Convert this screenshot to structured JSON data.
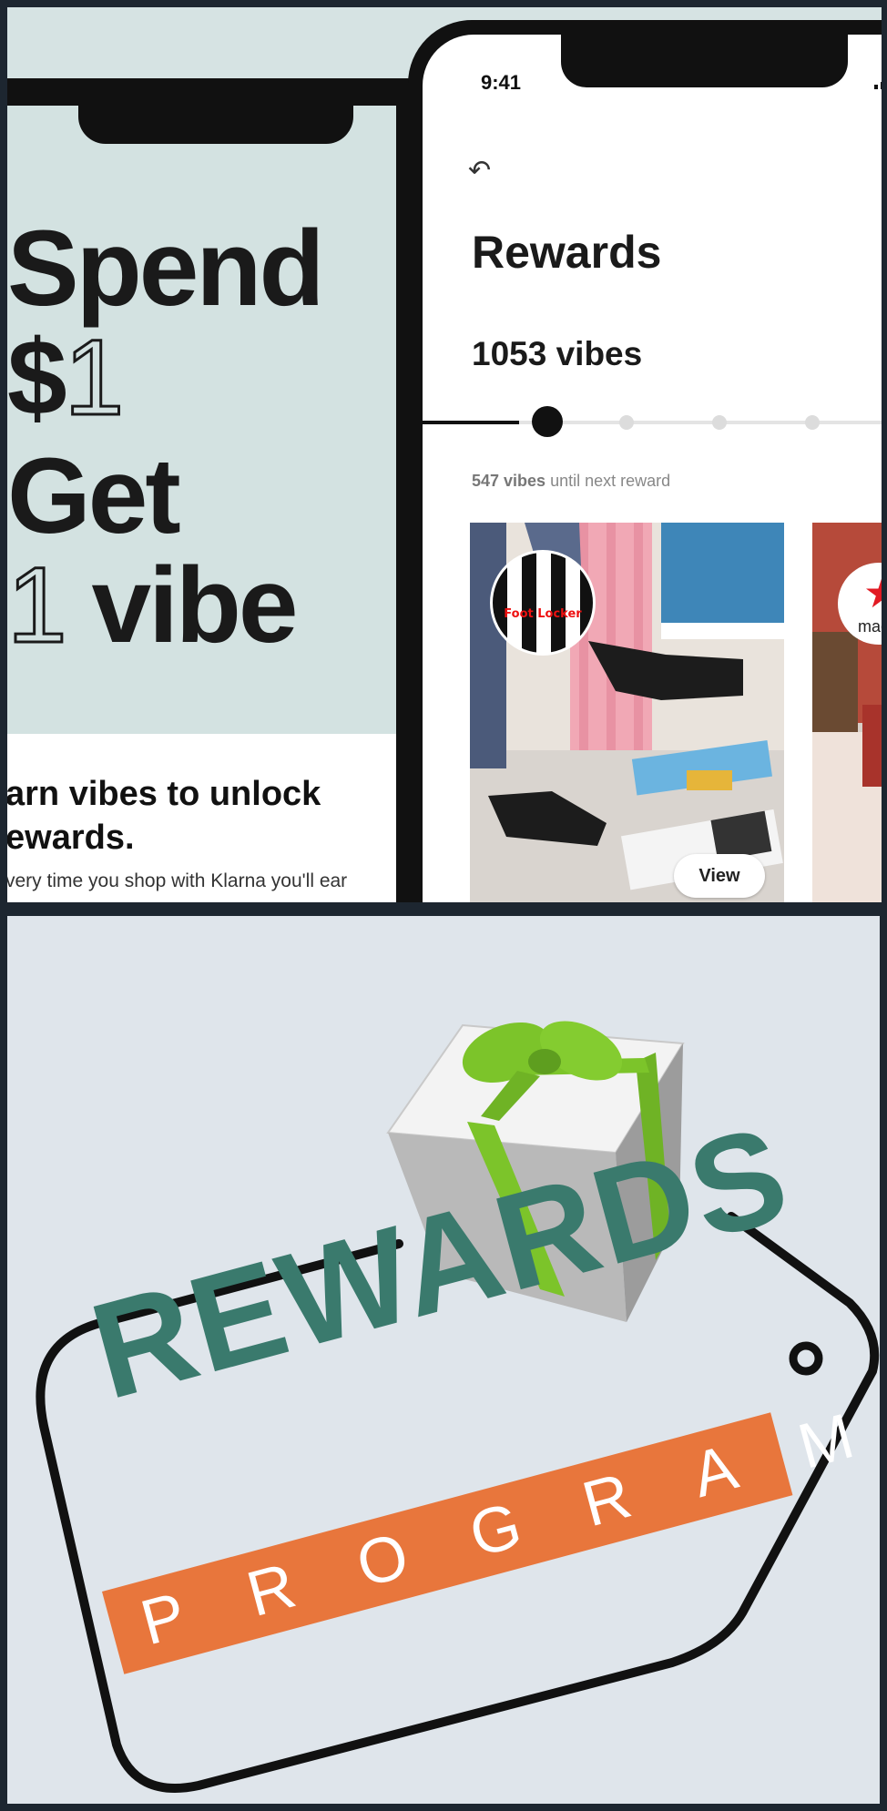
{
  "promo": {
    "line1": "Spend",
    "line2_currency": "$",
    "line2_number": "1",
    "line3": "Get",
    "line4_number": "1",
    "line4_word": "vibe",
    "heading": "arn vibes to unlock\newards.",
    "body": "very time you shop with Klarna you'll ear"
  },
  "app": {
    "status_time": "9:41",
    "title": "Rewards",
    "vibes_count": "1053 vibes",
    "vibes_remaining_bold": "547 vibes",
    "vibes_remaining_rest": "until next reward",
    "progress_fraction": 0.2,
    "cards": [
      {
        "brand": "Foot Locker",
        "button": "View"
      },
      {
        "brand": "mac"
      }
    ]
  },
  "program": {
    "rewards_word": "REWARDS",
    "program_word": "PROGRAM",
    "colors": {
      "rewards_green": "#3a7a6d",
      "band_orange": "#e8763c",
      "ribbon_green": "#7cc42a"
    }
  },
  "icons": [
    "back-arrow-icon",
    "signal-icon",
    "gift-box-icon",
    "star-icon"
  ]
}
